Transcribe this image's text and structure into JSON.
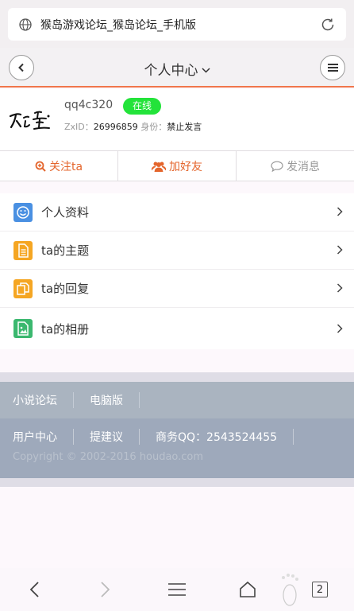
{
  "browser": {
    "url_title": "猴岛游戏论坛_猴岛论坛_手机版",
    "tab_count": "2"
  },
  "header": {
    "title": "个人中心"
  },
  "profile": {
    "username": "qq4c320",
    "status": "在线",
    "zxid_label": "ZxID：",
    "zxid_value": "26996859",
    "role_label": " 身份：",
    "role_value": "禁止发言"
  },
  "actions": {
    "follow": "关注ta",
    "add_friend": "加好友",
    "message": "发消息"
  },
  "menu": {
    "items": [
      {
        "label": "个人资料",
        "color": "#4a90e2"
      },
      {
        "label": "ta的主题",
        "color": "#f5a623"
      },
      {
        "label": "ta的回复",
        "color": "#f5a623"
      },
      {
        "label": "ta的相册",
        "color": "#3bb86f"
      }
    ]
  },
  "footer": {
    "nav1": [
      "小说论坛",
      "电脑版"
    ],
    "nav2": [
      "用户中心",
      "提建议",
      "商务QQ：2543524455"
    ],
    "copyright": "Copyright © 2002-2016 houdao.com"
  },
  "colors": {
    "accent": "#f0764b",
    "online": "#23e33a",
    "footer_bg": "#aab4c0"
  }
}
